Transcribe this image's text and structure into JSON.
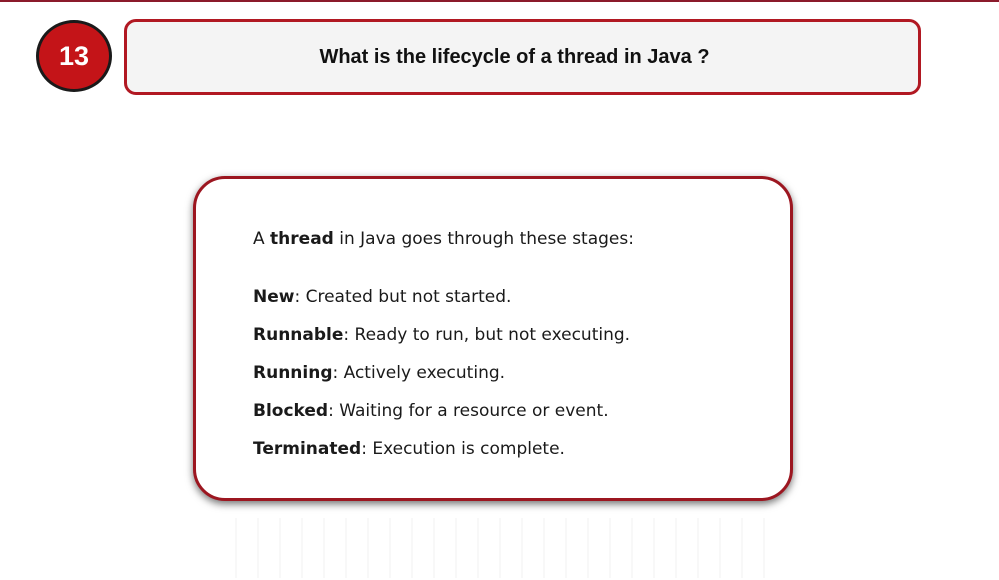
{
  "slide": {
    "number": "13",
    "question": "What is the lifecycle of a thread in Java ?"
  },
  "answer": {
    "intro_prefix": "A ",
    "intro_bold": "thread",
    "intro_suffix": " in Java goes through these stages:",
    "stages": [
      {
        "name": "New",
        "description": ": Created but not started."
      },
      {
        "name": "Runnable",
        "description": ": Ready to run, but not executing."
      },
      {
        "name": "Running",
        "description": ": Actively executing."
      },
      {
        "name": "Blocked",
        "description": ": Waiting for a resource or event."
      },
      {
        "name": "Terminated",
        "description": ": Execution is complete."
      }
    ]
  },
  "colors": {
    "accent_red": "#c41418",
    "border_red": "#b11822",
    "question_bg": "#f4f4f4"
  }
}
